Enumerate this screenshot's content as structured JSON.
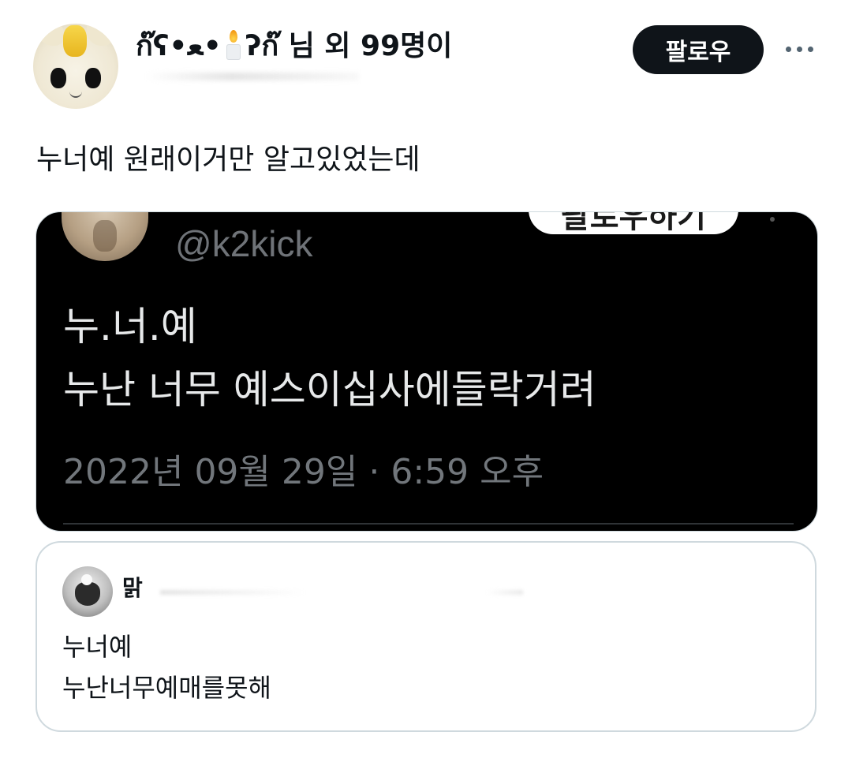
{
  "header": {
    "display_name_prefix": "ก๊ʕ•ﻌ•",
    "display_name_suffix": "ʔก๊ 님 외 99명이",
    "follow_label": "팔로우"
  },
  "tweet": {
    "text": "누너예 원래이거만 알고있었는데"
  },
  "embedded_image": {
    "follow_label": "팔로우하기",
    "handle": "@k2kick",
    "line1": "누.너.예",
    "line2": "누난 너무 예스이십사에들락거려",
    "timestamp": "2022년 09월 29일 · 6:59 오후"
  },
  "quote": {
    "name": "맑",
    "line1": "누너예",
    "line2": "누난너무예매를못해"
  },
  "icons": {
    "candle": "candle-icon",
    "more": "more-icon"
  }
}
